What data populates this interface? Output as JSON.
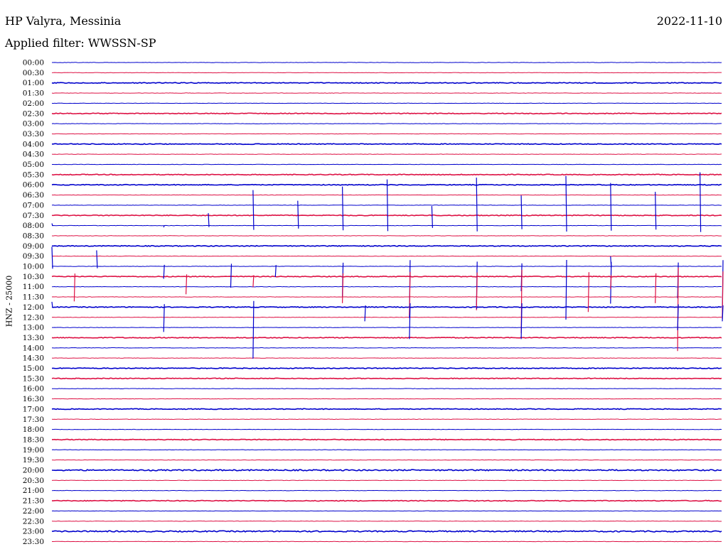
{
  "header": {
    "station": "HP Valyra, Messinia",
    "date": "2022-11-10",
    "filter": "Applied filter: WWSSN-SP",
    "channel": "HNZ - 25000"
  },
  "colors": {
    "blue": "#0000cc",
    "red": "#dd1144"
  },
  "chart_data": {
    "type": "line",
    "title": "HP Valyra, Messinia",
    "subtitle": "Applied filter: WWSSN-SP",
    "ylabel": "HNZ - 25000",
    "trace_colors": [
      "#0000cc",
      "#dd1144"
    ],
    "row_labels": [
      "00:00",
      "00:30",
      "01:00",
      "01:30",
      "02:00",
      "02:30",
      "03:00",
      "03:30",
      "04:00",
      "04:30",
      "05:00",
      "05:30",
      "06:00",
      "06:30",
      "07:00",
      "07:30",
      "08:00",
      "08:30",
      "09:00",
      "09:30",
      "10:00",
      "10:30",
      "11:00",
      "11:30",
      "12:00",
      "12:30",
      "13:00",
      "13:30",
      "14:00",
      "14:30",
      "15:00",
      "15:30",
      "16:00",
      "16:30",
      "17:00",
      "17:30",
      "18:00",
      "18:30",
      "19:00",
      "19:30",
      "20:00",
      "20:30",
      "21:00",
      "21:30",
      "22:00",
      "22:30",
      "23:00",
      "23:30"
    ],
    "row_noise": [
      1,
      1,
      2,
      1,
      1,
      2,
      1,
      1,
      2,
      1,
      1,
      2,
      2,
      1,
      1,
      2,
      1,
      1,
      2,
      1,
      1,
      2,
      1,
      1,
      2,
      1,
      1,
      2,
      1,
      1,
      2,
      2,
      1,
      1,
      2,
      1,
      1,
      2,
      1,
      1,
      3,
      1,
      1,
      2,
      1,
      1,
      3,
      1
    ],
    "events": [
      {
        "row": 16,
        "minute": 0,
        "amplitude": 6
      },
      {
        "row": 16,
        "minute": 5,
        "amplitude": -5
      },
      {
        "row": 16,
        "minute": 7,
        "amplitude": 35
      },
      {
        "row": 16,
        "minute": 9,
        "amplitude": 100
      },
      {
        "row": 16,
        "minute": 11,
        "amplitude": 70
      },
      {
        "row": 16,
        "minute": 13,
        "amplitude": 110
      },
      {
        "row": 16,
        "minute": 15,
        "amplitude": 130
      },
      {
        "row": 16,
        "minute": 17,
        "amplitude": 55
      },
      {
        "row": 16,
        "minute": 19,
        "amplitude": 135
      },
      {
        "row": 16,
        "minute": 21,
        "amplitude": 85
      },
      {
        "row": 16,
        "minute": 23,
        "amplitude": 140
      },
      {
        "row": 16,
        "minute": 25,
        "amplitude": 120
      },
      {
        "row": 16,
        "minute": 27,
        "amplitude": 95
      },
      {
        "row": 16,
        "minute": 29,
        "amplitude": 150
      },
      {
        "row": 20,
        "minute": 0,
        "amplitude": 55
      },
      {
        "row": 20,
        "minute": 2,
        "amplitude": 45
      },
      {
        "row": 20,
        "minute": 5,
        "amplitude": -35
      },
      {
        "row": 20,
        "minute": 8,
        "amplitude": -60
      },
      {
        "row": 20,
        "minute": 10,
        "amplitude": -30
      },
      {
        "row": 20,
        "minute": 13,
        "amplitude": -85
      },
      {
        "row": 20,
        "minute": 16,
        "amplitude": -145
      },
      {
        "row": 20,
        "minute": 19,
        "amplitude": -110
      },
      {
        "row": 20,
        "minute": 21,
        "amplitude": -70
      },
      {
        "row": 20,
        "minute": 23,
        "amplitude": -150
      },
      {
        "row": 20,
        "minute": 25,
        "amplitude": -105
      },
      {
        "row": 20,
        "minute": 28,
        "amplitude": -90
      },
      {
        "row": 20,
        "minute": 30,
        "amplitude": -145
      },
      {
        "row": 20,
        "minute": 32,
        "amplitude": -135
      },
      {
        "row": 20,
        "minute": 34,
        "amplitude": -185
      },
      {
        "row": 20,
        "minute": 37,
        "amplitude": -150
      },
      {
        "row": 20,
        "minute": 43,
        "amplitude": 12
      },
      {
        "row": 20,
        "minute": 45,
        "amplitude": -40
      },
      {
        "row": 20,
        "minute": 49,
        "amplitude": -75
      },
      {
        "row": 20,
        "minute": 52,
        "amplitude": -60
      },
      {
        "row": 20,
        "minute": 55,
        "amplitude": -120
      },
      {
        "row": 20,
        "minute": 57,
        "amplitude": -60
      },
      {
        "row": 20,
        "minute": 59,
        "amplitude": -95
      },
      {
        "row": 20,
        "minute": 25,
        "amplitude": 28
      },
      {
        "row": 20,
        "minute": 33,
        "amplitude": 95
      },
      {
        "row": 20,
        "minute": 35,
        "amplitude": 110
      },
      {
        "row": 20,
        "minute": 36,
        "amplitude": 90
      },
      {
        "row": 20,
        "minute": 40,
        "amplitude": 28
      },
      {
        "row": 20,
        "minute": 41,
        "amplitude": 105
      },
      {
        "row": 20,
        "minute": 45,
        "amplitude": 35
      },
      {
        "row": 20,
        "minute": 47,
        "amplitude": 80
      },
      {
        "row": 20,
        "minute": 48,
        "amplitude": 60
      },
      {
        "row": 20,
        "minute": 50,
        "amplitude": 40
      },
      {
        "row": 20,
        "minute": 52,
        "amplitude": 55
      },
      {
        "row": 20,
        "minute": 54,
        "amplitude": -85
      },
      {
        "row": 20,
        "minute": 56,
        "amplitude": 95
      },
      {
        "row": 20,
        "minute": 58,
        "amplitude": 125
      },
      {
        "row": 21,
        "minute": 1,
        "amplitude": -70
      },
      {
        "row": 21,
        "minute": 6,
        "amplitude": -50
      },
      {
        "row": 21,
        "minute": 9,
        "amplitude": -30
      },
      {
        "row": 21,
        "minute": 13,
        "amplitude": -75
      },
      {
        "row": 21,
        "minute": 16,
        "amplitude": -110
      },
      {
        "row": 21,
        "minute": 19,
        "amplitude": -95
      },
      {
        "row": 21,
        "minute": 21,
        "amplitude": -160
      },
      {
        "row": 21,
        "minute": 24,
        "amplitude": -100
      },
      {
        "row": 21,
        "minute": 25,
        "amplitude": -35
      },
      {
        "row": 21,
        "minute": 27,
        "amplitude": -75
      },
      {
        "row": 21,
        "minute": 28,
        "amplitude": -210
      },
      {
        "row": 21,
        "minute": 30,
        "amplitude": -120
      },
      {
        "row": 21,
        "minute": 31,
        "amplitude": -120
      },
      {
        "row": 21,
        "minute": 33,
        "amplitude": -150
      },
      {
        "row": 21,
        "minute": 38,
        "amplitude": -35
      },
      {
        "row": 21,
        "minute": 42,
        "amplitude": -80
      },
      {
        "row": 21,
        "minute": 46,
        "amplitude": -150
      },
      {
        "row": 21,
        "minute": 48,
        "amplitude": -45
      },
      {
        "row": 21,
        "minute": 49,
        "amplitude": -150
      },
      {
        "row": 21,
        "minute": 52,
        "amplitude": -85
      },
      {
        "row": 21,
        "minute": 55,
        "amplitude": -75
      },
      {
        "row": 21,
        "minute": 58,
        "amplitude": -230
      },
      {
        "row": 21,
        "minute": 57,
        "amplitude": -115
      },
      {
        "row": 21,
        "minute": 59,
        "amplitude": -30
      },
      {
        "row": 24,
        "minute": 0,
        "amplitude": 15
      },
      {
        "row": 24,
        "minute": 5,
        "amplitude": -70
      },
      {
        "row": 24,
        "minute": 9,
        "amplitude": -145
      },
      {
        "row": 24,
        "minute": 14,
        "amplitude": -40
      },
      {
        "row": 24,
        "minute": 16,
        "amplitude": -90
      },
      {
        "row": 24,
        "minute": 19,
        "amplitude": -5
      },
      {
        "row": 24,
        "minute": 21,
        "amplitude": -90
      },
      {
        "row": 24,
        "minute": 28,
        "amplitude": -65
      },
      {
        "row": 24,
        "minute": 30,
        "amplitude": -40
      },
      {
        "row": 24,
        "minute": 34,
        "amplitude": -50
      },
      {
        "row": 24,
        "minute": 37,
        "amplitude": -75
      },
      {
        "row": 24,
        "minute": 42,
        "amplitude": -40
      },
      {
        "row": 24,
        "minute": 46,
        "amplitude": -45
      },
      {
        "row": 24,
        "minute": 52,
        "amplitude": -25
      },
      {
        "row": 24,
        "minute": 54,
        "amplitude": -60
      },
      {
        "row": 24,
        "minute": 57,
        "amplitude": -30
      }
    ]
  }
}
